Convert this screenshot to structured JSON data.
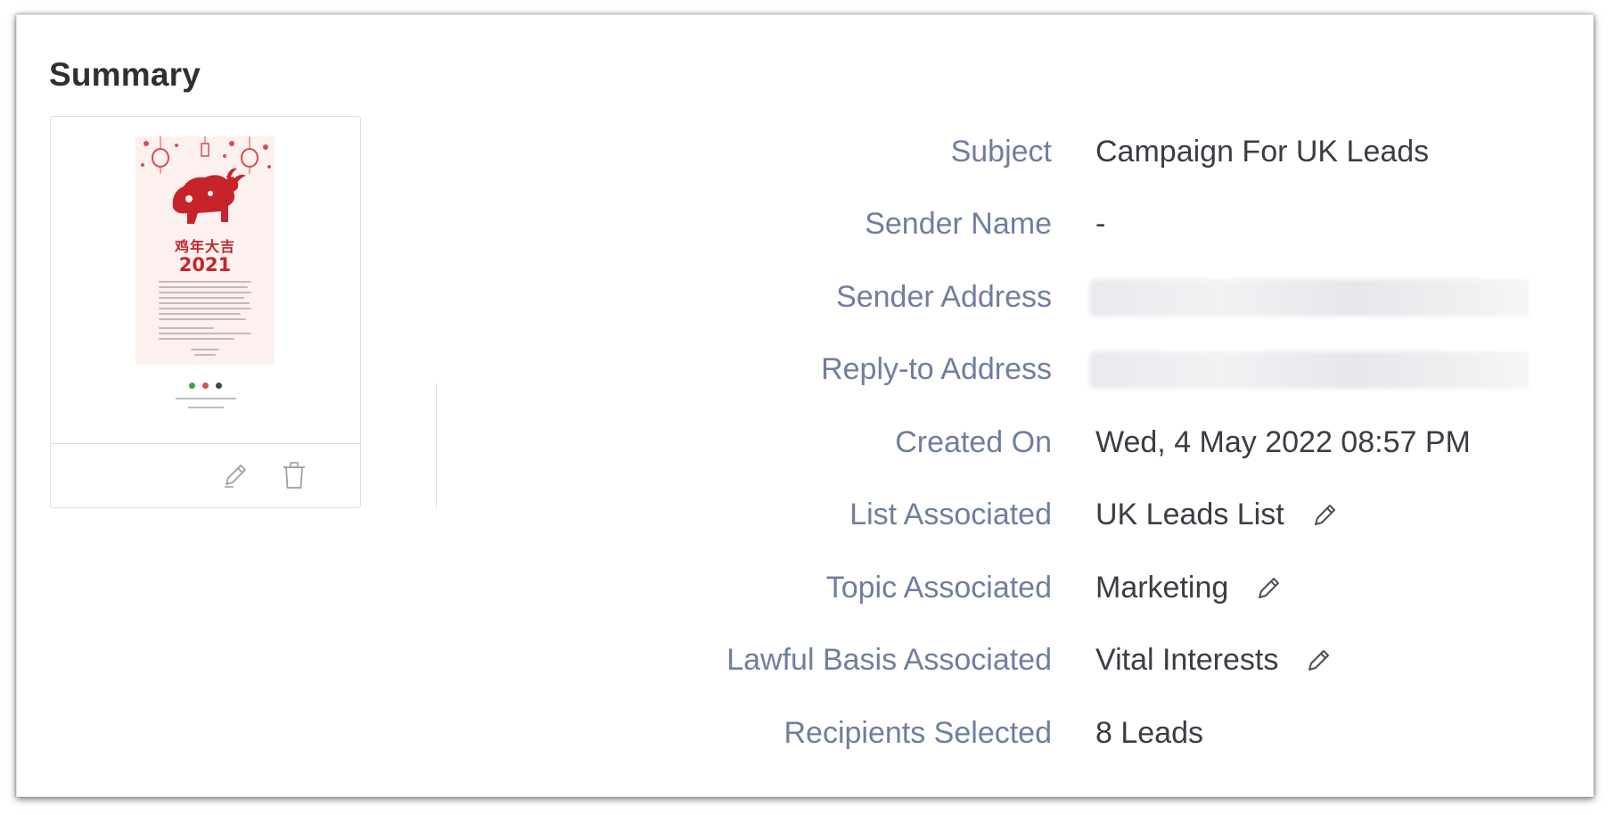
{
  "summary": {
    "title": "Summary"
  },
  "preview": {
    "thumb_chinese_text": "鸡年大吉",
    "thumb_year": "2021",
    "edit_icon": "pencil-icon",
    "delete_icon": "trash-icon"
  },
  "fields": [
    {
      "label": "Subject",
      "value": "Campaign For UK Leads"
    },
    {
      "label": "Sender Name",
      "value": "-"
    },
    {
      "label": "Sender Address",
      "value": ""
    },
    {
      "label": "Reply-to Address",
      "value": ""
    },
    {
      "label": "Created On",
      "value": "Wed, 4 May 2022 08:57 PM"
    },
    {
      "label": "List Associated",
      "value": "UK Leads List"
    },
    {
      "label": "Topic Associated",
      "value": "Marketing"
    },
    {
      "label": "Lawful Basis Associated",
      "value": "Vital Interests"
    },
    {
      "label": "Recipients Selected",
      "value": "8 Leads"
    }
  ],
  "colors": {
    "label": "#6f7ea0",
    "value": "#3a3d44",
    "title": "#2f3034",
    "thumb_accent": "#c7232b"
  }
}
